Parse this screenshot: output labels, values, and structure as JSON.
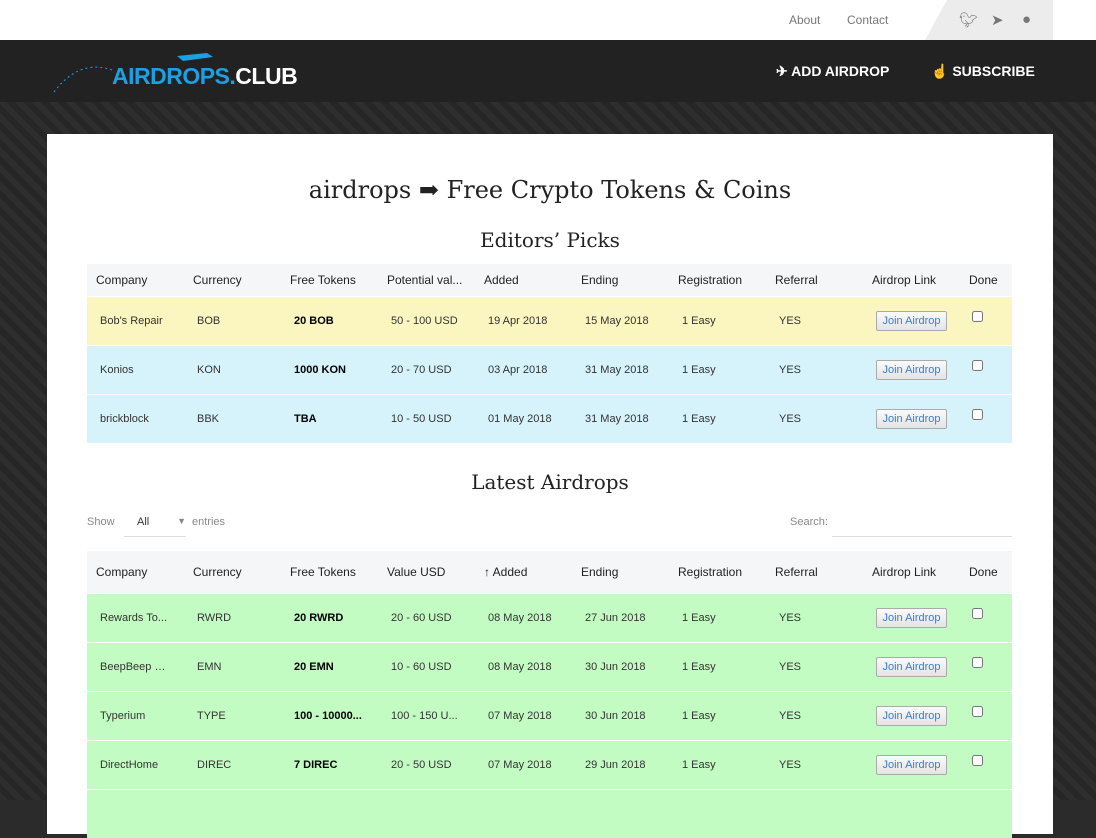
{
  "top": {
    "about": "About",
    "contact": "Contact"
  },
  "social": {
    "twitter": "twitter-icon",
    "telegram": "telegram-icon",
    "reddit": "reddit-icon"
  },
  "logo": {
    "part1": "AIRDROPS.",
    "part2": "CLUB"
  },
  "nav": {
    "add": "ADD AIRDROP",
    "subscribe": "SUBSCRIBE"
  },
  "title": "airdrops ➡ Free Crypto Tokens & Coins",
  "editors": {
    "heading": "Editors’ Picks",
    "columns": [
      "Company",
      "Currency",
      "Free Tokens",
      "Potential val...",
      "Added",
      "Ending",
      "Registration",
      "Referral",
      "Airdrop Link",
      "Done"
    ],
    "rows": [
      {
        "company": "Bob's Repair",
        "currency": "BOB",
        "tokens": "20 BOB",
        "value": "50 - 100 USD",
        "added": "19 Apr 2018",
        "ending": "15 May 2018",
        "registration": "1 Easy",
        "referral": "YES",
        "link": "Join Airdrop",
        "color": "#fbf5c0"
      },
      {
        "company": "Konios",
        "currency": "KON",
        "tokens": "1000 KON",
        "value": "20 - 70 USD",
        "added": "03 Apr 2018",
        "ending": "31 May 2018",
        "registration": "1 Easy",
        "referral": "YES",
        "link": "Join Airdrop",
        "color": "#d6f3fb"
      },
      {
        "company": "brickblock",
        "currency": "BBK",
        "tokens": "TBA",
        "value": "10 - 50 USD",
        "added": "01 May 2018",
        "ending": "31 May 2018",
        "registration": "1 Easy",
        "referral": "YES",
        "link": "Join Airdrop",
        "color": "#d6f3fb"
      }
    ]
  },
  "latest": {
    "heading": "Latest Airdrops",
    "show": "Show",
    "entries_value": "All",
    "entries": "entries",
    "search": "Search:",
    "search_value": "",
    "columns": [
      "Company",
      "Currency",
      "Free Tokens",
      "Value USD",
      "↑  Added",
      "Ending",
      "Registration",
      "Referral",
      "Airdrop Link",
      "Done"
    ],
    "rows": [
      {
        "company": "Rewards To...",
        "currency": "RWRD",
        "tokens": "20 RWRD",
        "value": "20 - 60 USD",
        "added": "08 May 2018",
        "ending": "27 Jun 2018",
        "registration": "1 Easy",
        "referral": "YES",
        "link": "Join Airdrop"
      },
      {
        "company": "BeepBeep N...",
        "currency": "EMN",
        "tokens": "20 EMN",
        "value": "10 - 60 USD",
        "added": "08 May 2018",
        "ending": "30 Jun 2018",
        "registration": "1 Easy",
        "referral": "YES",
        "link": "Join Airdrop"
      },
      {
        "company": "Typerium",
        "currency": "TYPE",
        "tokens": "100 - 10000...",
        "value": "100 - 150 U...",
        "added": "07 May 2018",
        "ending": "30 Jun 2018",
        "registration": "1 Easy",
        "referral": "YES",
        "link": "Join Airdrop"
      },
      {
        "company": "DirectHome",
        "currency": "DIREC",
        "tokens": "7 DIREC",
        "value": "20 - 50 USD",
        "added": "07 May 2018",
        "ending": "29 Jun 2018",
        "registration": "1 Easy",
        "referral": "YES",
        "link": "Join Airdrop"
      },
      {
        "company": "",
        "currency": "",
        "tokens": "",
        "value": "",
        "added": "",
        "ending": "",
        "registration": "",
        "referral": "",
        "link": ""
      }
    ]
  }
}
